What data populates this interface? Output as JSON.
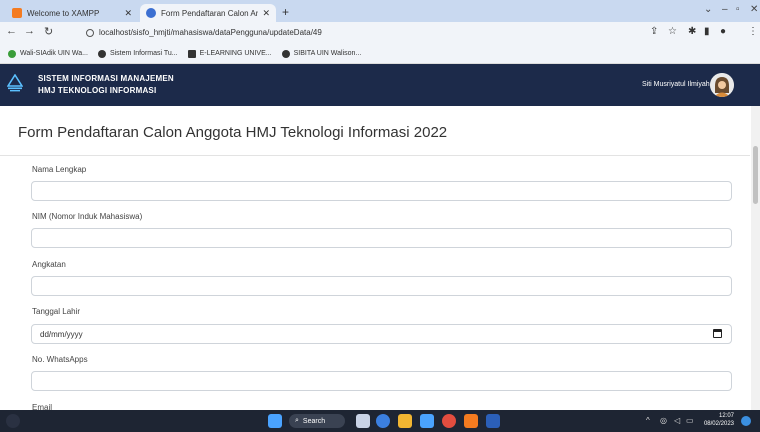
{
  "browser": {
    "tabs": [
      {
        "title": "Welcome to XAMPP",
        "favicon": "xampp-icon",
        "color": "#f47b20"
      },
      {
        "title": "Form Pendaftaran Calon Anggota",
        "favicon": "globe-icon",
        "color": "#3c6fd1"
      }
    ],
    "new_tab": "+",
    "url": "localhost/sisfo_hmjti/mahasiswa/dataPengguna/updateData/49",
    "bookmarks": [
      {
        "label": "Wali-SIAdik UIN Wa...",
        "icon": "bookmark-icon",
        "color": "#3a9d3a"
      },
      {
        "label": "Sistem Informasi Tu...",
        "icon": "globe-icon",
        "color": "#333333"
      },
      {
        "label": "E-LEARNING UNIVE...",
        "icon": "elearning-icon",
        "color": "#333333"
      },
      {
        "label": "SIBITA UIN Walison...",
        "icon": "globe-icon",
        "color": "#333333"
      }
    ]
  },
  "header": {
    "app_name_line1": "SISTEM INFORMASI MANAJEMEN",
    "app_name_line2": "HMJ TEKNOLOGI INFORMASI",
    "user_name": "Siti Musriyatul Ilmiyah",
    "background": "#1c2a4a"
  },
  "form": {
    "title": "Form Pendaftaran Calon Anggota HMJ Teknologi Informasi 2022",
    "fields": [
      {
        "label": "Nama Lengkap",
        "value": ""
      },
      {
        "label": "NIM (Nomor Induk Mahasiswa)",
        "value": ""
      },
      {
        "label": "Angkatan",
        "value": ""
      },
      {
        "label": "Tanggal Lahir",
        "value": "dd/mm/yyyy"
      },
      {
        "label": "No. WhatsApps",
        "value": ""
      },
      {
        "label": "Email",
        "value": ""
      }
    ]
  },
  "taskbar": {
    "search_label": "Search",
    "time": "12:07",
    "date": "08/02/2023"
  }
}
